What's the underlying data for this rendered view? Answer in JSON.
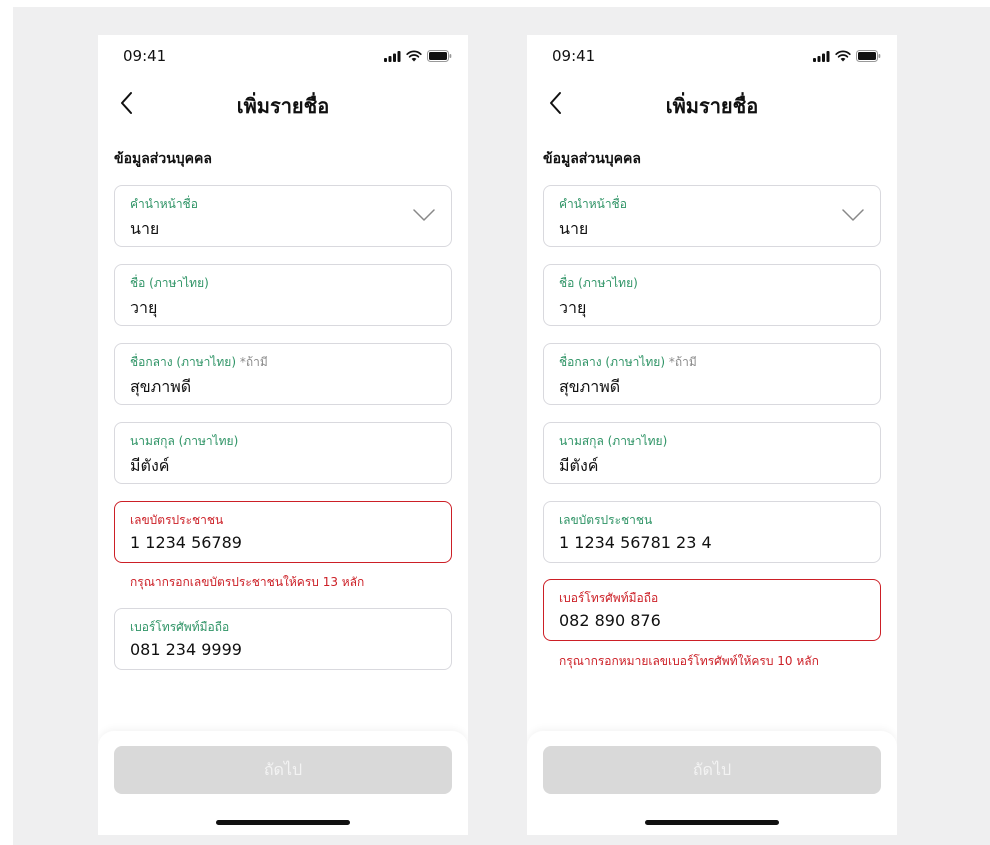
{
  "screens": [
    {
      "status": {
        "time": "09:41"
      },
      "header": {
        "title": "เพิ่มรายชื่อ"
      },
      "section_title": "ข้อมูลส่วนบุคคล",
      "fields": {
        "prefix": {
          "label": "คำนำหน้าชื่อ",
          "value": "นาย"
        },
        "first_name": {
          "label": "ชื่อ (ภาษาไทย)",
          "value": "วายุ"
        },
        "middle_name": {
          "label": "ชื่อกลาง (ภาษาไทย)",
          "optional": "*ถ้ามี",
          "value": "สุขภาพดี"
        },
        "last_name": {
          "label": "นามสกุล (ภาษาไทย)",
          "value": "มีตังค์"
        },
        "id_card": {
          "label": "เลขบัตรประชาชน",
          "value": "1 1234 56789",
          "error": "กรุณากรอกเลขบัตรประชาชนให้ครบ 13 หลัก"
        },
        "phone": {
          "label": "เบอร์โทรศัพท์มือถือ",
          "value": "081 234 9999"
        }
      },
      "next_button": "ถัดไป"
    },
    {
      "status": {
        "time": "09:41"
      },
      "header": {
        "title": "เพิ่มรายชื่อ"
      },
      "section_title": "ข้อมูลส่วนบุคคล",
      "fields": {
        "prefix": {
          "label": "คำนำหน้าชื่อ",
          "value": "นาย"
        },
        "first_name": {
          "label": "ชื่อ (ภาษาไทย)",
          "value": "วายุ"
        },
        "middle_name": {
          "label": "ชื่อกลาง (ภาษาไทย)",
          "optional": "*ถ้ามี",
          "value": "สุขภาพดี"
        },
        "last_name": {
          "label": "นามสกุล (ภาษาไทย)",
          "value": "มีตังค์"
        },
        "id_card": {
          "label": "เลขบัตรประชาชน",
          "value": "1 1234 56781 23 4"
        },
        "phone": {
          "label": "เบอร์โทรศัพท์มือถือ",
          "value": "082 890 876",
          "error": "กรุณากรอกหมายเลขเบอร์โทรศัพท์ให้ครบ 10 หลัก"
        }
      },
      "next_button": "ถัดไป"
    }
  ],
  "colors": {
    "accent_label": "#2f9466",
    "error": "#cc1f26",
    "border": "#d9d9de",
    "disabled_button": "#d9d9d9"
  },
  "icons": [
    "signal-icon",
    "wifi-icon",
    "battery-icon",
    "back-chevron-icon",
    "chevron-down-icon"
  ]
}
